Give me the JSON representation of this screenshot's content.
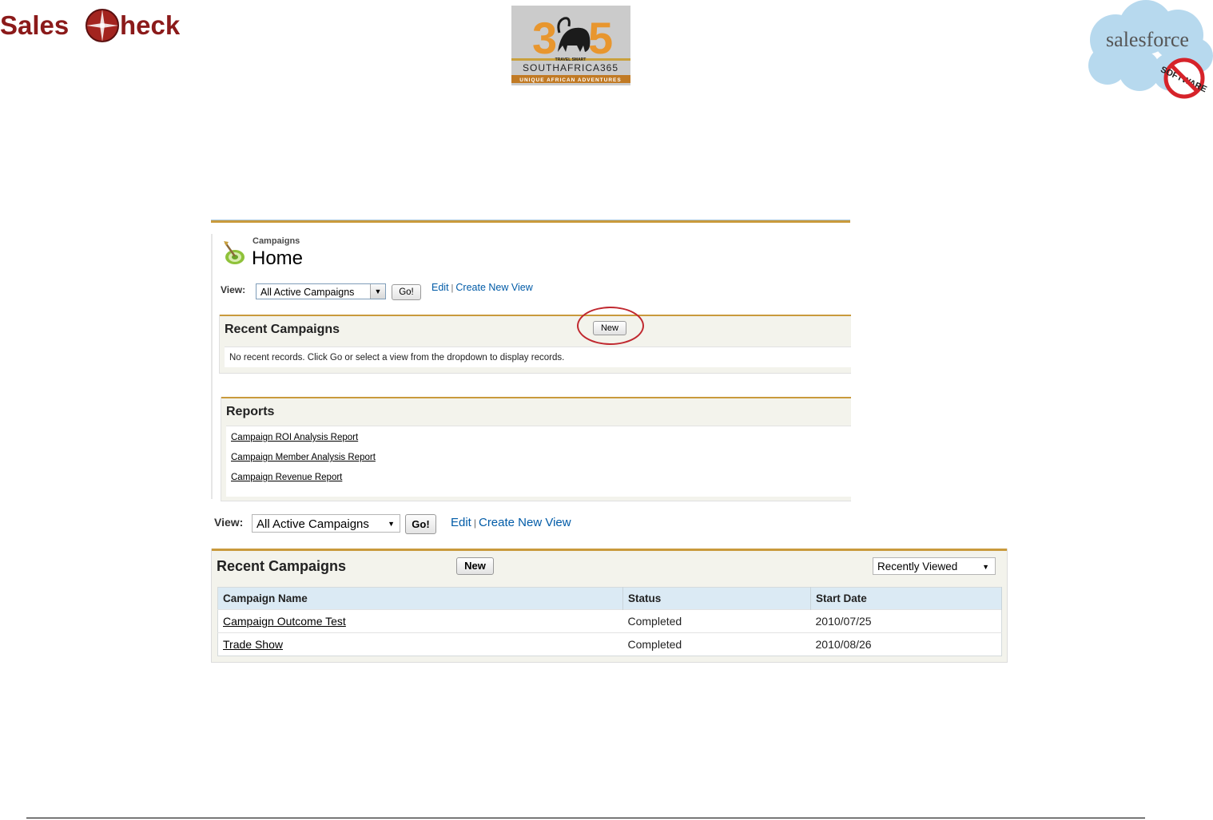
{
  "logos": {
    "salescheck": "SalesCheck",
    "sa365_travel": "TRAVEL SMART",
    "sa365_name": "SOUTHAFRICA365",
    "sa365_tagline": "UNIQUE AFRICAN ADVENTURES",
    "salesforce": "salesforce",
    "no_software": "SOFTWARE"
  },
  "panel1": {
    "breadcrumb": "Campaigns",
    "title": "Home",
    "view_label": "View:",
    "view_value": "All Active Campaigns",
    "go_label": "Go!",
    "edit_link": "Edit",
    "separator": "|",
    "create_link": "Create New View",
    "recent": {
      "title": "Recent Campaigns",
      "new_label": "New",
      "empty_message": "No recent records. Click Go or select a view from the dropdown to display records."
    },
    "reports": {
      "title": "Reports",
      "items": [
        "Campaign ROI Analysis Report",
        "Campaign Member Analysis Report",
        "Campaign Revenue Report"
      ]
    }
  },
  "panel2": {
    "view_label": "View:",
    "view_value": "All Active Campaigns",
    "go_label": "Go!",
    "edit_link": "Edit",
    "separator": "|",
    "create_link": "Create New View",
    "recent": {
      "title": "Recent Campaigns",
      "new_label": "New",
      "filter_value": "Recently Viewed",
      "columns": [
        "Campaign Name",
        "Status",
        "Start Date"
      ],
      "rows": [
        {
          "name": "Campaign Outcome Test",
          "status": "Completed",
          "start": "2010/07/25"
        },
        {
          "name": "Trade Show",
          "status": "Completed",
          "start": "2010/08/26"
        }
      ]
    }
  },
  "colors": {
    "accent_gold": "#c99a3c",
    "link_blue": "#015ba7",
    "highlight_red": "#c0282f",
    "brand_maroon": "#8b1a1a"
  }
}
